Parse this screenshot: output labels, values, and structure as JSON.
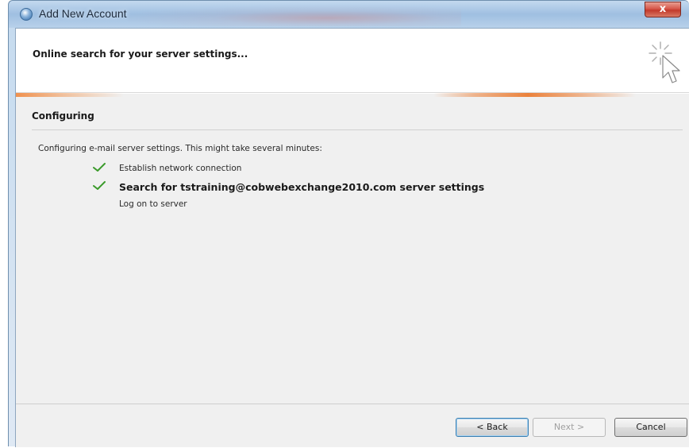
{
  "window": {
    "title": "Add New Account",
    "close_label": "x"
  },
  "header": {
    "title": "Online search for your server settings..."
  },
  "section": {
    "title": "Configuring",
    "intro": "Configuring e-mail server settings. This might take several minutes:"
  },
  "steps": [
    {
      "label": "Establish network connection",
      "status": "done",
      "bold": false
    },
    {
      "label": "Search for tstraining@cobwebexchange2010.com server settings",
      "status": "done",
      "bold": true
    },
    {
      "label": "Log on to server",
      "status": "pending",
      "bold": false
    }
  ],
  "buttons": {
    "back": "< Back",
    "next": "Next >",
    "cancel": "Cancel"
  },
  "colors": {
    "check": "#3a9a2a",
    "accent": "#eb823c",
    "titlebar": "#a9c6e4"
  },
  "icons": {
    "app": "outlook-globe-icon",
    "wizard": "searching-cursor-icon",
    "step_done": "green-check-icon"
  }
}
